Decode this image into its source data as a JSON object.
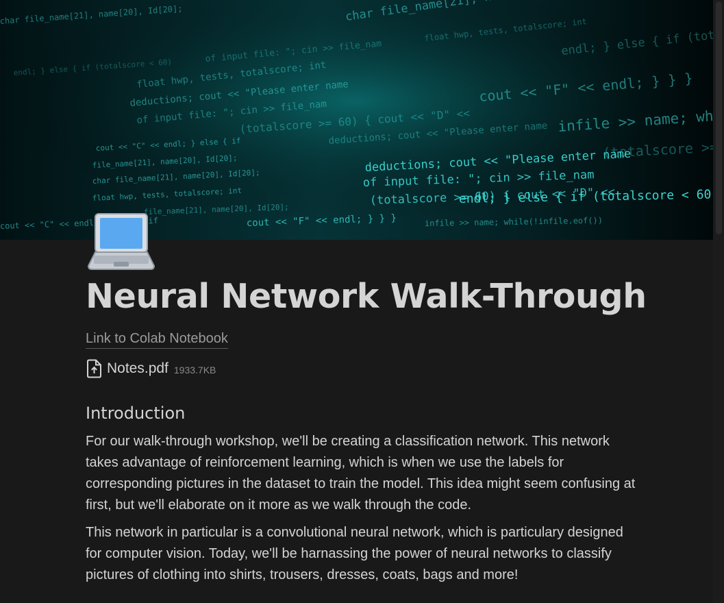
{
  "cover": {
    "image": "teal source code background",
    "code_lines": [
      "char file_name[21], name[20], Id[20];",
      "float hwp, tests, totalscore; int",
      "deductions; cout << \"Please enter name",
      "of input file: \"; cin >> file_nam",
      "(totalscore >= 60) { cout << \"D\" <<",
      "endl; } else { if (totalscore < 60)",
      "cout << \"F\" << endl; } } }",
      "infile >> name; while(!infile.eof())",
      "cout << \"C\" << endl; } else { if",
      "file_name[21], name[20], Id[20];"
    ]
  },
  "page": {
    "icon": "laptop-icon",
    "title": "Neural Network Walk-Through"
  },
  "links": {
    "colab": "Link to Colab Notebook"
  },
  "attachment": {
    "icon": "file-upload-icon",
    "name": "Notes.pdf",
    "size": "1933.7KB"
  },
  "intro": {
    "heading": "Introduction",
    "paragraphs": [
      "For our walk-through workshop, we'll be creating a classification network. This network takes advantage of reinforcement learning, which is when we use the labels for corresponding pictures in the dataset to train the model. This idea might seem confusing at first, but we'll elaborate on it more as we walk through the code.",
      "This network in particular is a convolutional neural network, which is particulary designed for computer vision. Today, we'll be harnassing the power of neural networks to classify pictures of clothing into shirts, trousers, dresses, coats, bags and more!"
    ]
  },
  "colors": {
    "background": "#191919",
    "text": "#d4d4d4",
    "muted": "#9b9b9b",
    "code_glow": "#2ed3d0"
  }
}
